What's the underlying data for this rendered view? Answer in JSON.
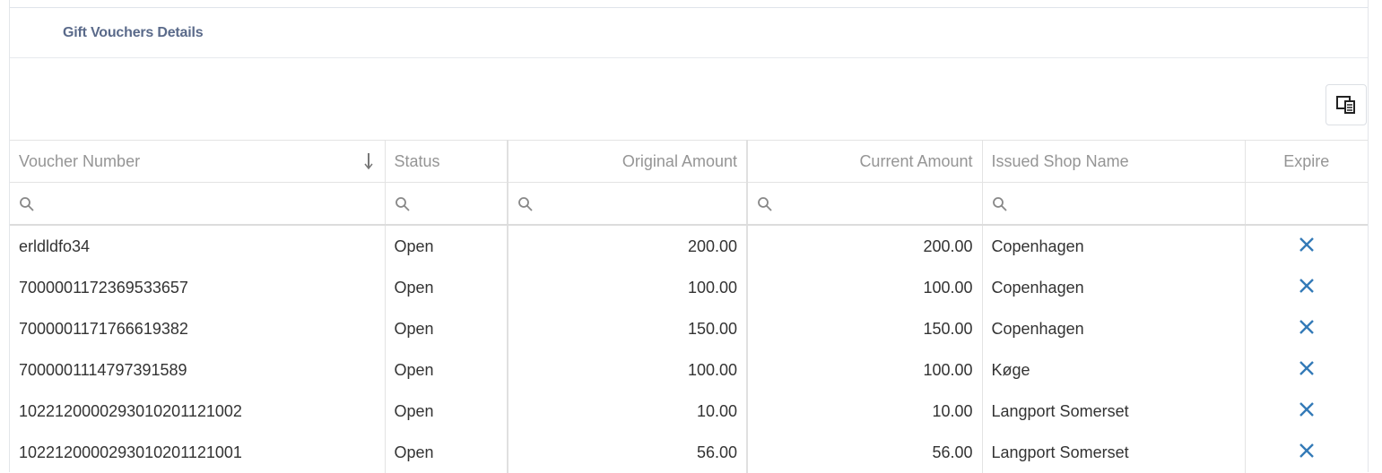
{
  "panel": {
    "title": "Gift Vouchers Details"
  },
  "toolbar": {
    "column_chooser_icon": "column-chooser-icon"
  },
  "columns": [
    {
      "label": "Voucher Number",
      "sort": "descending"
    },
    {
      "label": "Status"
    },
    {
      "label": "Original Amount"
    },
    {
      "label": "Current Amount"
    },
    {
      "label": "Issued Shop Name"
    },
    {
      "label": "Expire"
    }
  ],
  "rows": [
    {
      "voucher": "erldldfo34",
      "status": "Open",
      "original": "200.00",
      "current": "200.00",
      "shop": "Copenhagen"
    },
    {
      "voucher": "7000001172369533657",
      "status": "Open",
      "original": "100.00",
      "current": "100.00",
      "shop": "Copenhagen"
    },
    {
      "voucher": "7000001171766619382",
      "status": "Open",
      "original": "150.00",
      "current": "150.00",
      "shop": "Copenhagen"
    },
    {
      "voucher": "7000001114797391589",
      "status": "Open",
      "original": "100.00",
      "current": "100.00",
      "shop": "Køge"
    },
    {
      "voucher": "1022120000293010201121002",
      "status": "Open",
      "original": "10.00",
      "current": "10.00",
      "shop": "Langport Somerset"
    },
    {
      "voucher": "1022120000293010201121001",
      "status": "Open",
      "original": "56.00",
      "current": "56.00",
      "shop": "Langport Somerset"
    }
  ],
  "colors": {
    "accent": "#337ab7",
    "title": "#5a6a8a",
    "header_text": "#959595"
  }
}
